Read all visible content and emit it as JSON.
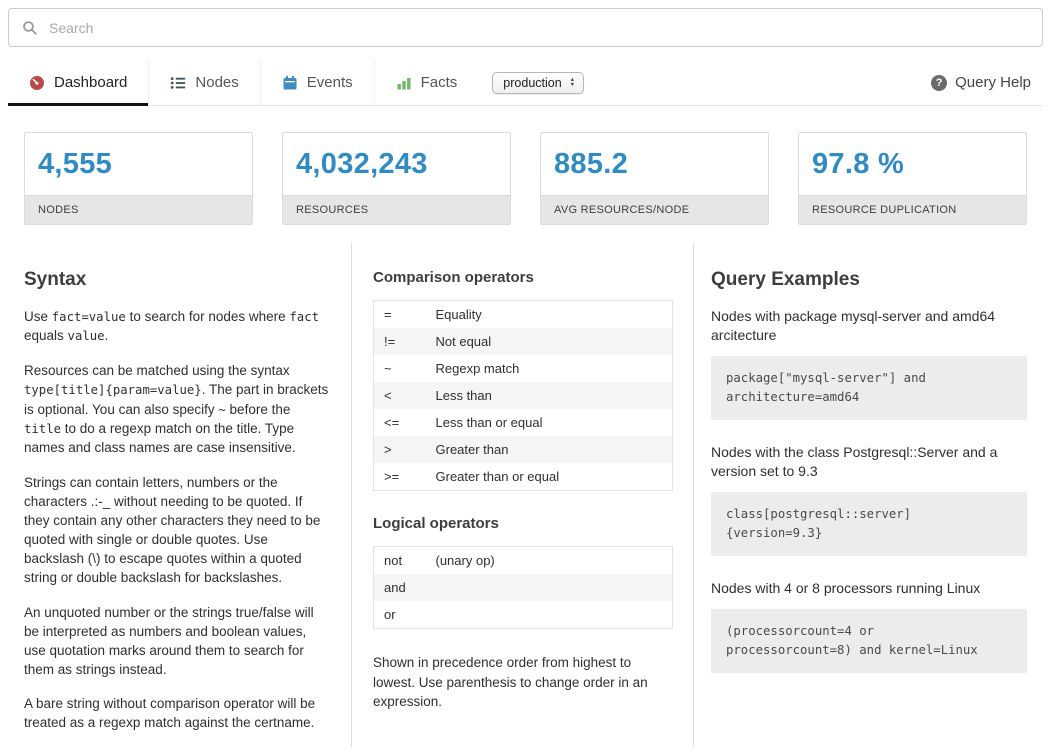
{
  "search": {
    "placeholder": "Search"
  },
  "nav": {
    "tabs": [
      {
        "label": "Dashboard",
        "active": true
      },
      {
        "label": "Nodes",
        "active": false
      },
      {
        "label": "Events",
        "active": false
      },
      {
        "label": "Facts",
        "active": false
      }
    ],
    "environment": "production",
    "help": "Query Help"
  },
  "stats": [
    {
      "value": "4,555",
      "label": "NODES"
    },
    {
      "value": "4,032,243",
      "label": "RESOURCES"
    },
    {
      "value": "885.2",
      "label": "AVG RESOURCES/NODE"
    },
    {
      "value": "97.8 %",
      "label": "RESOURCE DUPLICATION"
    }
  ],
  "syntax": {
    "title": "Syntax",
    "paragraphs": [
      [
        {
          "t": "text",
          "v": "Use "
        },
        {
          "t": "code",
          "v": "fact=value"
        },
        {
          "t": "text",
          "v": " to search for nodes where "
        },
        {
          "t": "code",
          "v": "fact"
        },
        {
          "t": "text",
          "v": " equals "
        },
        {
          "t": "code",
          "v": "value"
        },
        {
          "t": "text",
          "v": "."
        }
      ],
      [
        {
          "t": "text",
          "v": "Resources can be matched using the syntax "
        },
        {
          "t": "code",
          "v": "type[title]{param=value}"
        },
        {
          "t": "text",
          "v": ". The part in brackets is optional. You can also specify "
        },
        {
          "t": "code",
          "v": "~"
        },
        {
          "t": "text",
          "v": " before the "
        },
        {
          "t": "code",
          "v": "title"
        },
        {
          "t": "text",
          "v": " to do a regexp match on the title. Type names and class names are case insensitive."
        }
      ],
      [
        {
          "t": "text",
          "v": "Strings can contain letters, numbers or the characters .:-_ without needing to be quoted. If they contain any other characters they need to be quoted with single or double quotes. Use backslash (\\) to escape quotes within a quoted string or double backslash for backslashes."
        }
      ],
      [
        {
          "t": "text",
          "v": "An unquoted number or the strings true/false will be interpreted as numbers and boolean values, use quotation marks around them to search for them as strings instead."
        }
      ],
      [
        {
          "t": "text",
          "v": "A bare string without comparison operator will be treated as a regexp match against the certname."
        }
      ]
    ]
  },
  "operators": {
    "comparison_title": "Comparison operators",
    "comparison": [
      {
        "op": "=",
        "desc": "Equality"
      },
      {
        "op": "!=",
        "desc": "Not equal"
      },
      {
        "op": "~",
        "desc": "Regexp match"
      },
      {
        "op": "<",
        "desc": "Less than"
      },
      {
        "op": "<=",
        "desc": "Less than or equal"
      },
      {
        "op": ">",
        "desc": "Greater than"
      },
      {
        "op": ">=",
        "desc": "Greater than or equal"
      }
    ],
    "logical_title": "Logical operators",
    "logical": [
      {
        "op": "not",
        "desc": "(unary op)"
      },
      {
        "op": "and",
        "desc": ""
      },
      {
        "op": "or",
        "desc": ""
      }
    ],
    "note": "Shown in precedence order from highest to lowest. Use parenthesis to change order in an expression."
  },
  "examples": {
    "title": "Query Examples",
    "items": [
      {
        "desc": "Nodes with package mysql-server and amd64 arcitecture",
        "code": "package[\"mysql-server\"] and\narchitecture=amd64"
      },
      {
        "desc": "Nodes with the class Postgresql::Server and a version set to 9.3",
        "code": "class[postgresql::server]\n{version=9.3}"
      },
      {
        "desc": "Nodes with 4 or 8 processors running Linux",
        "code": "(processorcount=4 or\nprocessorcount=8) and kernel=Linux"
      }
    ]
  },
  "colors": {
    "stat_value": "#2e8bc3",
    "dashboard_icon": "#b94a48",
    "nodes_icon": "#44525f",
    "events_icon": "#3f8dbf",
    "facts_icon": "#73b66b",
    "search_icon": "#9a9a9a"
  }
}
